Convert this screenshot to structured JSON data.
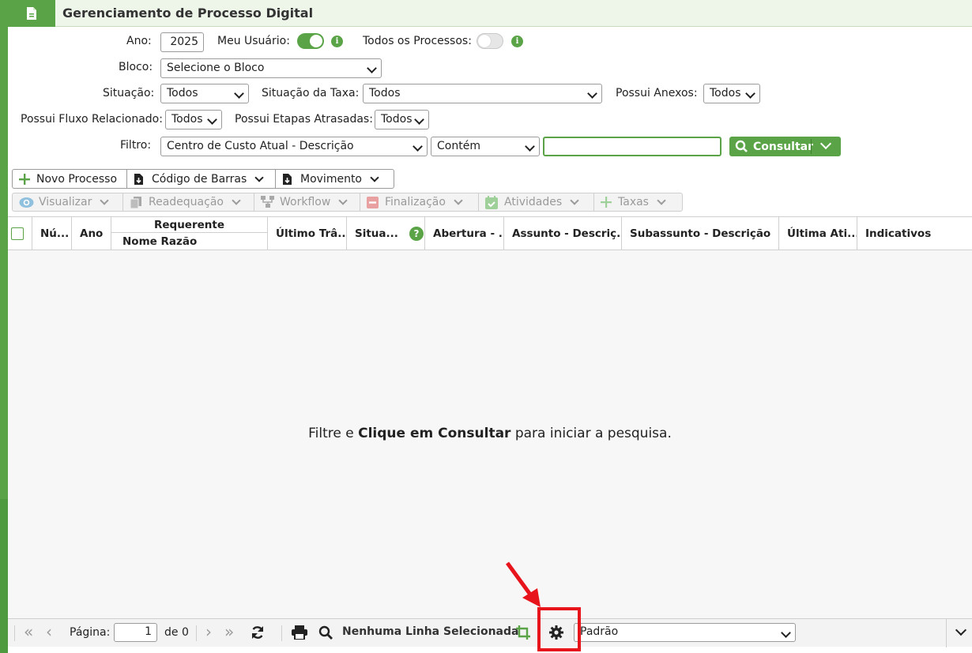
{
  "header": {
    "title": "Gerenciamento de Processo Digital"
  },
  "filters": {
    "ano_label": "Ano:",
    "ano_value": "2025",
    "meu_usuario_label": "Meu Usuário:",
    "todos_processos_label": "Todos os Processos:",
    "bloco_label": "Bloco:",
    "bloco_value": "Selecione o Bloco",
    "situacao_label": "Situação:",
    "situacao_value": "Todos",
    "situacao_taxa_label": "Situação da Taxa:",
    "situacao_taxa_value": "Todos",
    "possui_anexos_label": "Possui Anexos:",
    "possui_anexos_value": "Todos",
    "possui_fluxo_label": "Possui Fluxo Relacionado:",
    "possui_fluxo_value": "Todos",
    "possui_etapas_label": "Possui Etapas Atrasadas:",
    "possui_etapas_value": "Todos",
    "filtro_label": "Filtro:",
    "filtro_campo": "Centro de Custo Atual - Descrição",
    "filtro_operador": "Contém",
    "filtro_valor": "",
    "consultar_label": "Consultar"
  },
  "toolbar1": {
    "novo_processo": "Novo Processo",
    "codigo_barras": "Código de Barras",
    "movimento": "Movimento"
  },
  "toolbar2": {
    "visualizar": "Visualizar",
    "readequacao": "Readequação",
    "workflow": "Workflow",
    "finalizacao": "Finalização",
    "atividades": "Atividades",
    "taxas": "Taxas"
  },
  "grid": {
    "columns": {
      "numero": "Nú...",
      "ano": "Ano",
      "requerente": "Requerente",
      "nome_razao": "Nome Razão",
      "ultimo_tramite": "Último Trâ...",
      "situacao": "Situa...",
      "abertura": "Abertura - ...",
      "assunto": "Assunto - Descriç...",
      "subassunto": "Subassunto - Descrição",
      "ultima_atividade": "Última Ati...",
      "indicativos": "Indicativos"
    },
    "empty_prefix": "Filtre e ",
    "empty_bold": "Clique em Consultar",
    "empty_suffix": " para iniciar a pesquisa."
  },
  "footer": {
    "pagina_label": "Página:",
    "pagina_value": "1",
    "de_label": "de 0",
    "selection_status": "Nenhuma Linha Selecionada",
    "layout_value": "Padrão"
  },
  "colors": {
    "accent": "#5aa447",
    "highlight": "#e8141c"
  }
}
